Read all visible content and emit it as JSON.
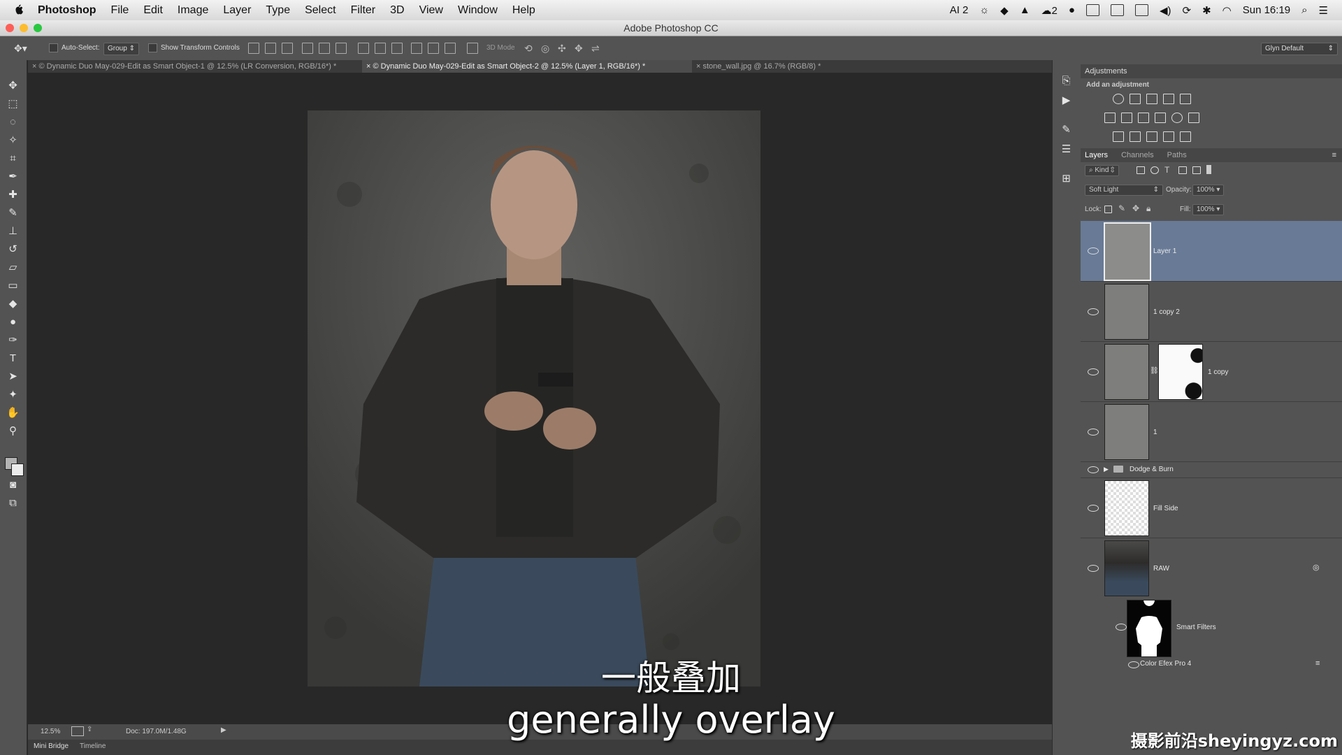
{
  "menubar": {
    "items": [
      "Photoshop",
      "File",
      "Edit",
      "Image",
      "Layer",
      "Type",
      "Select",
      "Filter",
      "3D",
      "View",
      "Window",
      "Help"
    ],
    "status_ai": "AI 2",
    "status_cloud": "2",
    "clock": "Sun 16:19"
  },
  "window": {
    "title": "Adobe Photoshop CC"
  },
  "options": {
    "auto_select_label": "Auto-Select:",
    "auto_select_value": "Group",
    "show_transform_label": "Show Transform Controls",
    "mode_3d": "3D Mode",
    "workspace": "Glyn Default"
  },
  "tabs": [
    "© Dynamic Duo May-029-Edit as Smart Object-1 @ 12.5% (LR Conversion, RGB/16*) *",
    "© Dynamic Duo May-029-Edit as Smart Object-2 @ 12.5% (Layer 1, RGB/16*) *",
    "stone_wall.jpg @ 16.7% (RGB/8) *"
  ],
  "status": {
    "zoom": "12.5%",
    "doc": "Doc: 197.0M/1.48G"
  },
  "bottom_tabs": [
    "Mini Bridge",
    "Timeline"
  ],
  "adjustments": {
    "title": "Adjustments",
    "subtitle": "Add an adjustment"
  },
  "layers_panel": {
    "tabs": [
      "Layers",
      "Channels",
      "Paths"
    ],
    "filter": "Kind",
    "blend_mode": "Soft Light",
    "opacity_label": "Opacity:",
    "opacity": "100%",
    "lock_label": "Lock:",
    "fill_label": "Fill:",
    "fill": "100%",
    "layers": [
      "Layer 1",
      "1 copy 2",
      "1 copy",
      "1",
      "Dodge & Burn",
      "Fill Side",
      "RAW",
      "Smart Filters",
      "Color Efex Pro 4"
    ]
  },
  "subtitles": {
    "cn": "一般叠加",
    "en": "generally overlay"
  },
  "watermark": "摄影前沿sheyingyz.com"
}
